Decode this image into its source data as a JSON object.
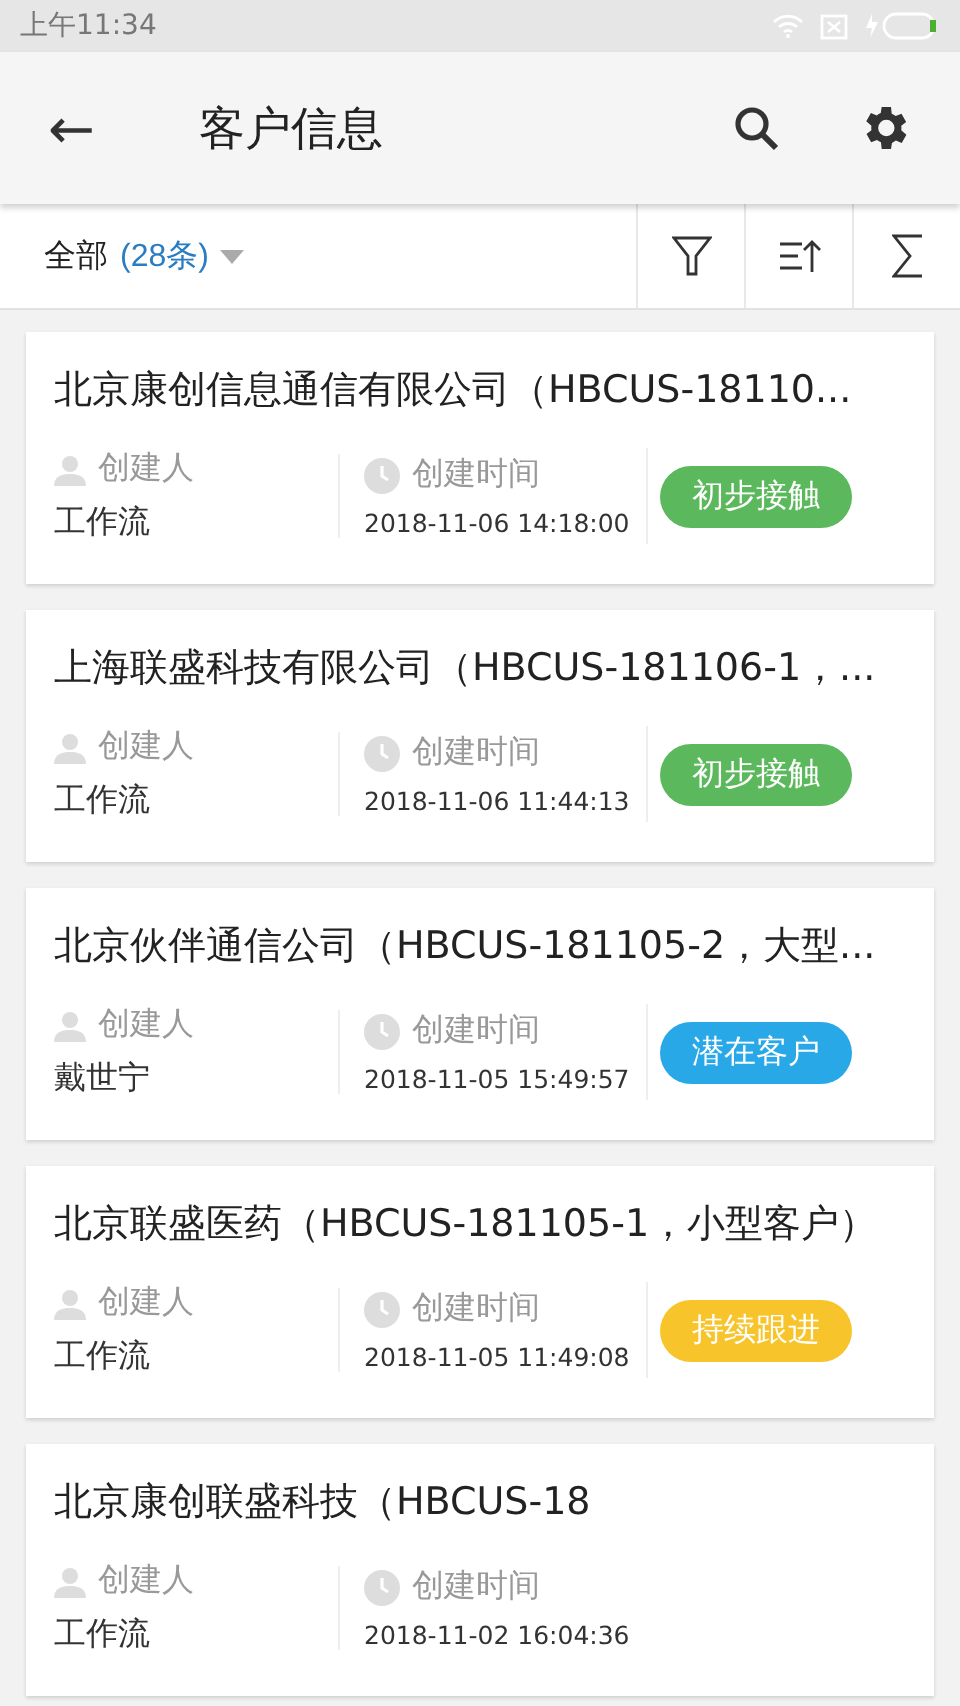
{
  "status_bar": {
    "time": "上午11:34"
  },
  "header": {
    "back": "←",
    "title": "客户信息"
  },
  "filter_bar": {
    "label": "全部",
    "count": "(28条)"
  },
  "cards": [
    {
      "title": "北京康创信息通信有限公司（HBCUS-18110...",
      "creator_label": "创建人",
      "creator": "工作流",
      "time_label": "创建时间",
      "time": "2018-11-06 14:18:00",
      "tag": "初步接触",
      "color": "#5cb85c"
    },
    {
      "title": "上海联盛科技有限公司（HBCUS-181106-1，...",
      "creator_label": "创建人",
      "creator": "工作流",
      "time_label": "创建时间",
      "time": "2018-11-06 11:44:13",
      "tag": "初步接触",
      "color": "#5cb85c"
    },
    {
      "title": "北京伙伴通信公司（HBCUS-181105-2，大型...",
      "creator_label": "创建人",
      "creator": "戴世宁",
      "time_label": "创建时间",
      "time": "2018-11-05 15:49:57",
      "tag": "潜在客户",
      "color": "#29a8e8"
    },
    {
      "title": "北京联盛医药（HBCUS-181105-1，小型客户）",
      "creator_label": "创建人",
      "creator": "工作流",
      "time_label": "创建时间",
      "time": "2018-11-05 11:49:08",
      "tag": "持续跟进",
      "color": "#f7c52b"
    },
    {
      "title": "北京康创联盛科技（HBCUS-18",
      "creator_label": "创建人",
      "creator": "工作流",
      "time_label": "创建时间",
      "time": "2018-11-02 16:04:36"
    }
  ]
}
